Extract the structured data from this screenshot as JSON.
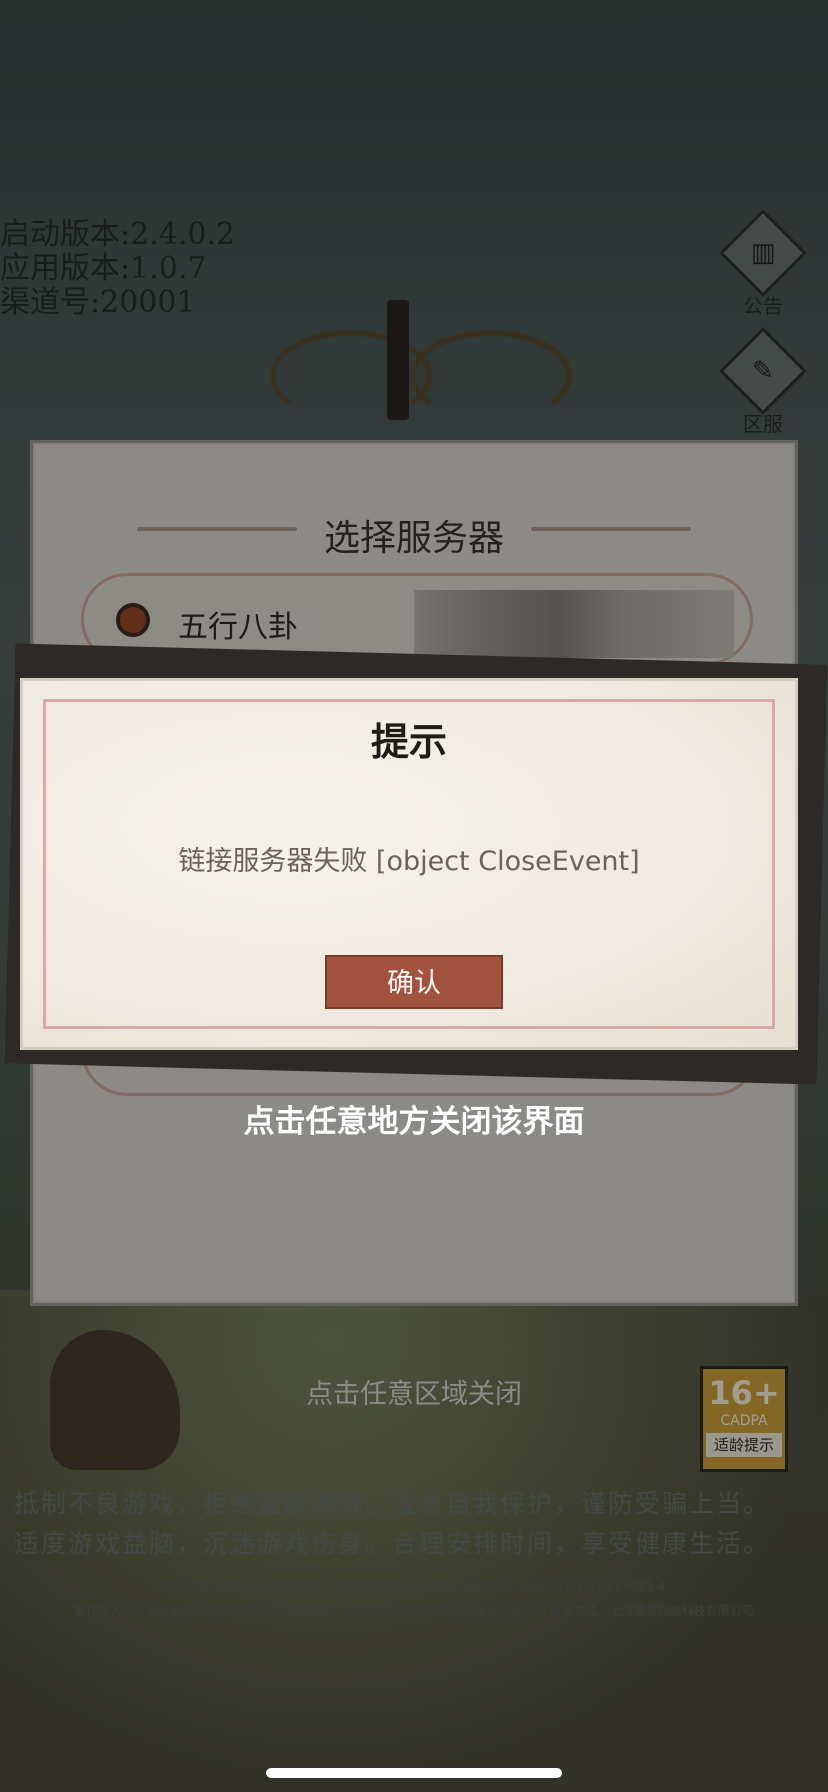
{
  "version_info": {
    "launch_version": "启动版本:2.4.0.2",
    "app_version": "应用版本:1.0.7",
    "channel": "渠道号:20001"
  },
  "side_buttons": {
    "notice": "公告",
    "server": "区服"
  },
  "server_panel": {
    "title": "选择服务器",
    "selected_server": "五行八卦"
  },
  "dialog": {
    "title": "提示",
    "message": "链接服务器失败 [object CloseEvent]",
    "confirm": "确认",
    "close_hint": "点击任意地方关闭该界面"
  },
  "footer": {
    "close_anywhere": "点击任意区域关闭",
    "age_rating": "16+",
    "age_org": "CADPA",
    "age_tip": "适龄提示",
    "health_line1": "抵制不良游戏，拒绝盗版游戏。注意自我保护，谨防受骗上当。",
    "health_line2": "适度游戏益脑，沉迷游戏伤身。合理安排时间，享受健康生活。",
    "info_line1": "游戏名称：我的门派 审批文号：国新出审[2021]772号 出版物号：ISBN978-7-498-09003-4",
    "info_line2": "著作权人：上海游晏网络科技有限公司 出版单位：华东师范大学电子音像出版社有限公司 运营单位：上海游晏网络科技有限公司"
  }
}
